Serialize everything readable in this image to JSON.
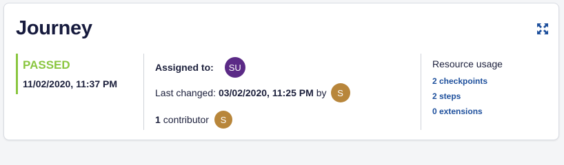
{
  "card": {
    "title": "Journey",
    "expand_icon": "expand-icon"
  },
  "status": {
    "label": "PASSED",
    "timestamp": "11/02/2020, 11:37 PM",
    "color": "#8ac63f"
  },
  "details": {
    "assigned_label": "Assigned to:",
    "assignee_initials": "SU",
    "assignee_color": "#5b2a86",
    "last_changed_label": "Last changed:",
    "last_changed_value": "03/02/2020, 11:25 PM",
    "by_label": "by",
    "changer_initials": "S",
    "changer_color": "#b8863b",
    "contributor_count": "1",
    "contributor_label": "contributor",
    "contributor_initials": "S",
    "contributor_color": "#b8863b"
  },
  "resources": {
    "title": "Resource usage",
    "links": [
      "2 checkpoints",
      "2 steps",
      "0 extensions"
    ]
  }
}
